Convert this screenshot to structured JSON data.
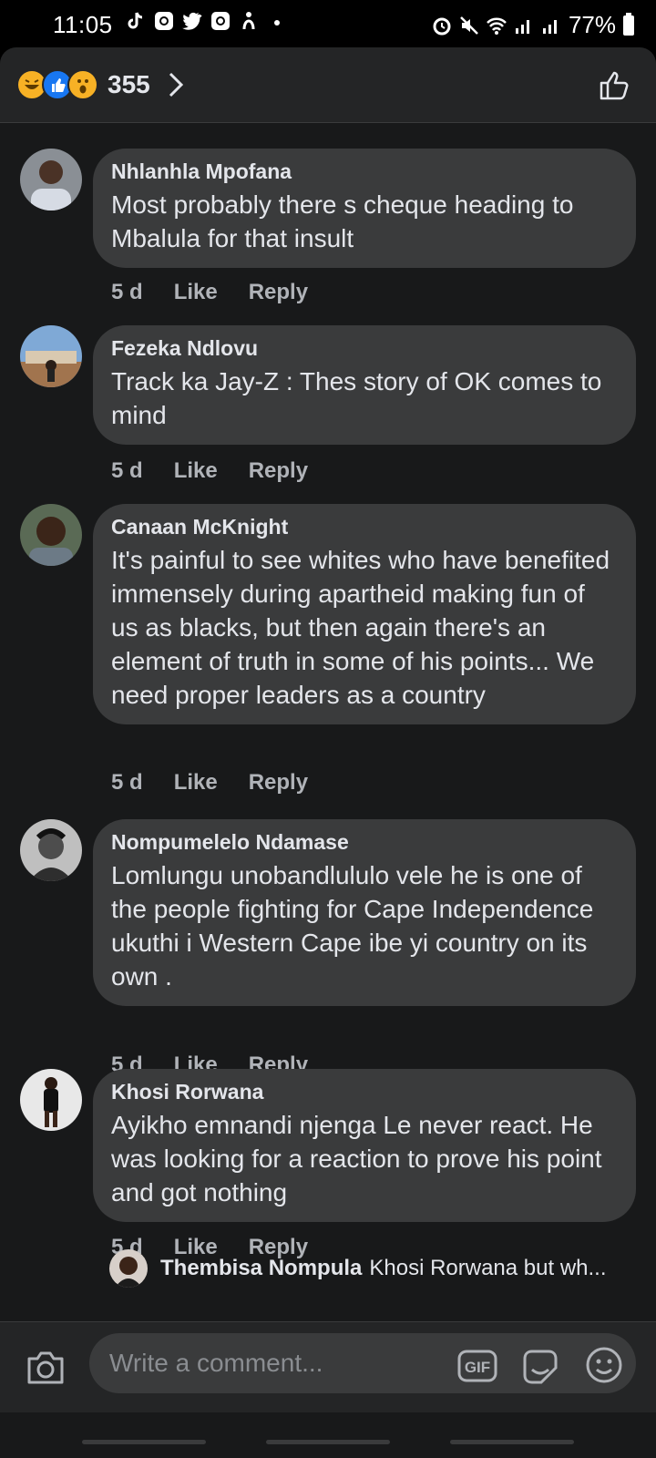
{
  "status_bar": {
    "time": "11:05",
    "battery": "77%"
  },
  "header": {
    "reaction_icons": [
      "haha-icon",
      "like-icon",
      "wow-icon"
    ],
    "reaction_count": "355"
  },
  "comments": [
    {
      "author": "Nhlanhla Mpofana",
      "text": "Most probably there s cheque heading to Mbalula for that insult",
      "time": "5 d",
      "like": "Like",
      "reply": "Reply"
    },
    {
      "author": "Fezeka Ndlovu",
      "text": "Track ka Jay-Z : Thes story of OK comes to mind",
      "time": "5 d",
      "like": "Like",
      "reply": "Reply"
    },
    {
      "author": "Canaan McKnight",
      "text": "It's painful to see whites who have benefited immensely during apartheid making fun of us as blacks, but then again there's an element of truth in some of his points... We need proper leaders as a country",
      "time": "5 d",
      "like": "Like",
      "reply": "Reply"
    },
    {
      "author": "Nompumelelo Ndamase",
      "text": "Lomlungu unobandlululo vele he is one of the people fighting for Cape Independence ukuthi i Western Cape ibe yi country on its own .",
      "time": "5 d",
      "like": "Like",
      "reply": "Reply"
    },
    {
      "author": "Khosi Rorwana",
      "text": "Ayikho emnandi njenga Le never react. He was looking for a reaction to prove his point and got nothing",
      "time": "5 d",
      "like": "Like",
      "reply": "Reply"
    }
  ],
  "reply_preview": {
    "author": "Thembisa Nompula",
    "text": "Khosi Rorwana but wh..."
  },
  "composer": {
    "placeholder": "Write a comment...",
    "gif_label": "GIF"
  },
  "colors": {
    "background": "#18191a",
    "bubble": "#3a3b3c",
    "bar": "#242526",
    "like_blue": "#1877f2",
    "reaction_yellow": "#f7b125"
  }
}
